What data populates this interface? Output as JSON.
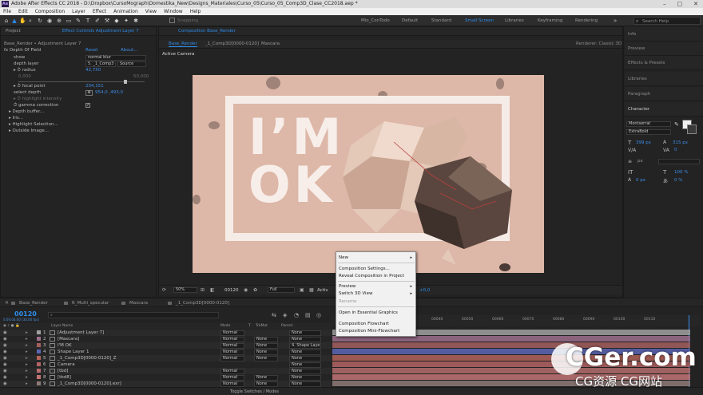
{
  "window": {
    "title": "Adobe After Effects CC 2018 - D:\\Dropbox\\CursoMograph\\Domestika_New\\Designs_Materiales\\Curso_05\\Curso_05_Comp3D_Clase_CC2018.aep *",
    "app_icon": "Ae"
  },
  "menu": [
    "File",
    "Edit",
    "Composition",
    "Layer",
    "Effect",
    "Animation",
    "View",
    "Window",
    "Help"
  ],
  "toolbar": {
    "snapping": "Snapping",
    "workspaces": [
      "Mio_ConTodo",
      "Default",
      "Standard",
      "Small Screen",
      "Libraries",
      "Keyframing",
      "Rendering"
    ],
    "active_workspace": "Small Screen",
    "search_placeholder": "Search Help"
  },
  "left_panel": {
    "tabs": [
      "Project",
      "Effect Controls Adjustment Layer 7"
    ],
    "header": "Base_Render • Adjustment Layer 7",
    "effect": {
      "name": "fx Depth Of Field",
      "reset": "Reset",
      "about": "About..."
    },
    "rows": [
      {
        "label": "show",
        "value": "normal blur"
      },
      {
        "label": "depth layer",
        "value": "5. _1_Comp3",
        "extra": "Source"
      },
      {
        "label": "radius",
        "value": "42,750"
      },
      {
        "label": "0,000",
        "value": "50,000"
      },
      {
        "label": "focal point",
        "value": "204,151"
      },
      {
        "label": "select depth",
        "value": "954,0 ,493,0"
      },
      {
        "label": "highlight intensity",
        "value": ""
      },
      {
        "label": "gamma correction",
        "value": ""
      },
      {
        "label": "Depth buffer...",
        "value": ""
      },
      {
        "label": "Iris...",
        "value": ""
      },
      {
        "label": "Highlight Selection...",
        "value": ""
      },
      {
        "label": "Outside Image...",
        "value": ""
      }
    ]
  },
  "comp_panel": {
    "title": "Composition Base_Render",
    "tabs": [
      "Base_Render",
      "_1_Comp3D[0000-0120]",
      "Mascara"
    ],
    "renderer": "Renderer: Classic 3D",
    "active_camera": "Active Camera",
    "viewer_text": "I’M OK",
    "zoom": "50%",
    "timecode": "00120",
    "resolution": "Full",
    "extra": "+0,0"
  },
  "right_panel": {
    "items": [
      "Info",
      "Preview",
      "Effects & Presets",
      "Libraries",
      "Paragraph",
      "Character"
    ],
    "character": {
      "font": "Montserrat",
      "style": "ExtraBold",
      "size": "399 px",
      "leading": "315 px",
      "kerning": "0",
      "stroke": "px",
      "scale_v": "100 %",
      "scale_h": "100 %",
      "baseline": "0 px",
      "tsume": "0 %"
    }
  },
  "context_menu": {
    "items": [
      {
        "label": "New",
        "submenu": true,
        "disabled": false
      },
      {
        "label": "Composition Settings...",
        "submenu": false,
        "disabled": false
      },
      {
        "label": "Reveal Composition in Project",
        "submenu": false,
        "disabled": false
      },
      {
        "label": "Preview",
        "submenu": true,
        "disabled": false
      },
      {
        "label": "Switch 3D View",
        "submenu": true,
        "disabled": false
      },
      {
        "label": "Rename",
        "submenu": false,
        "disabled": true
      },
      {
        "label": "Open in Essential Graphics",
        "submenu": false,
        "disabled": false
      },
      {
        "label": "Composition Flowchart",
        "submenu": false,
        "disabled": false
      },
      {
        "label": "Composition Mini-Flowchart",
        "submenu": false,
        "disabled": false
      }
    ]
  },
  "timeline": {
    "tabs": [
      "Base_Render",
      "R_Multi_specular",
      "Mascara",
      "_1_Comp3D[0000-0120]"
    ],
    "timecode": "00120",
    "timecode_sub": "0:00:04:00 (30,00 fps)",
    "columns": [
      "Layer Name",
      "Mode",
      "T",
      "TrkMat",
      "Parent"
    ],
    "ruler": [
      "00010",
      "00020",
      "00030",
      "00040",
      "00050",
      "00060",
      "00070",
      "00080",
      "00090",
      "00100",
      "00110"
    ],
    "layers": [
      {
        "num": "1",
        "name": "[Adjustment Layer 7]",
        "mode": "Normal",
        "trkmat": "",
        "parent": "None",
        "color": "#a1a1a1"
      },
      {
        "num": "2",
        "name": "[Mascara]",
        "mode": "Normal",
        "trkmat": "None",
        "parent": "None",
        "color": "#9d6f8d"
      },
      {
        "num": "3",
        "name": "I'M OK",
        "mode": "Normal",
        "trkmat": "None",
        "parent": "4. Shape Laye",
        "color": "#a55f5f"
      },
      {
        "num": "4",
        "name": "Shape Layer 1",
        "mode": "Normal",
        "trkmat": "None",
        "parent": "None",
        "color": "#5d66b6"
      },
      {
        "num": "5",
        "name": "_1_Comp3D[0000-0120]_Z",
        "mode": "Normal",
        "trkmat": "None",
        "parent": "None",
        "color": "#b4645b"
      },
      {
        "num": "6",
        "name": "Camera",
        "mode": "",
        "trkmat": "",
        "parent": "None",
        "color": "#b46464"
      },
      {
        "num": "7",
        "name": "[tbd]",
        "mode": "Normal",
        "trkmat": "",
        "parent": "None",
        "color": "#b56d6d"
      },
      {
        "num": "8",
        "name": "[tbd8]",
        "mode": "Normal",
        "trkmat": "None",
        "parent": "None",
        "color": "#c27474"
      },
      {
        "num": "9",
        "name": "_1_Comp3D[0000-0120].exr]",
        "mode": "Normal",
        "trkmat": "None",
        "parent": "None",
        "color": "#8f7a78"
      }
    ],
    "footer": "Toggle Switches / Modes"
  },
  "watermark": {
    "big": "CGer.com",
    "small": "CG资源 CG网站"
  }
}
